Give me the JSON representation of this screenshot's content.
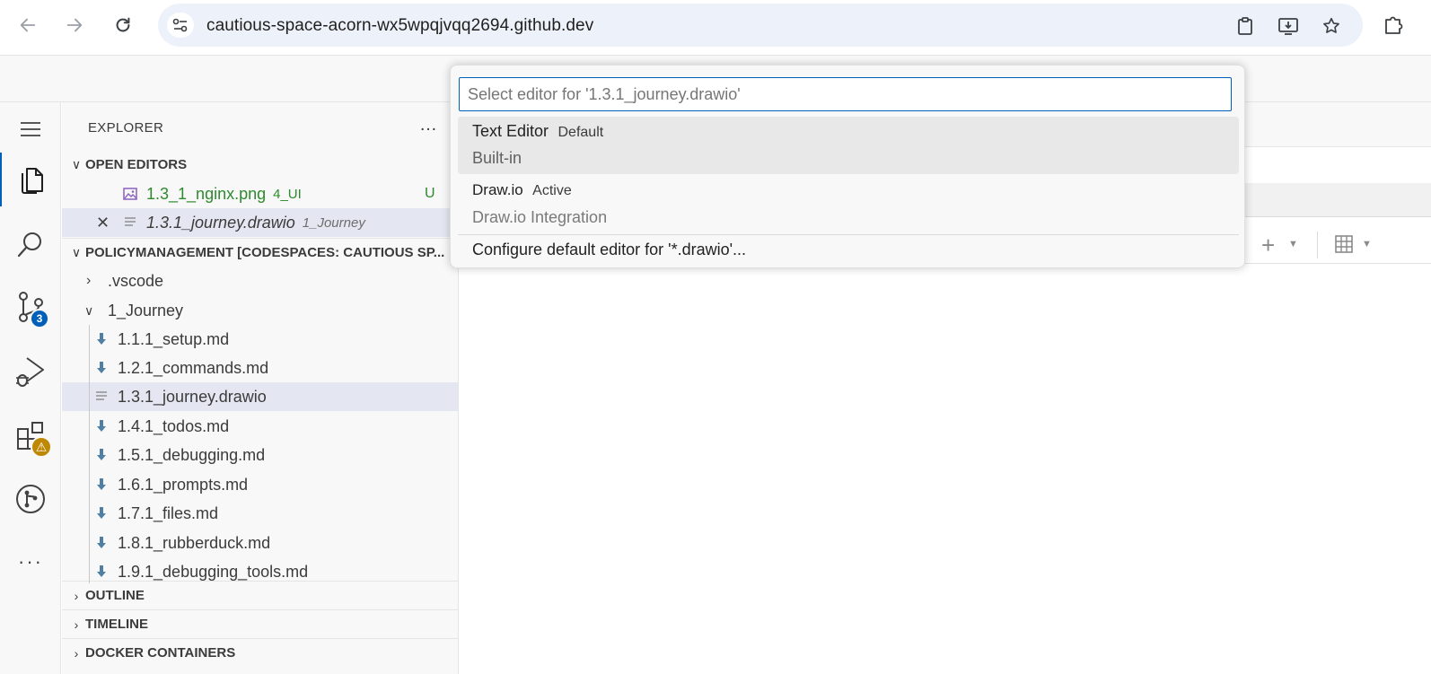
{
  "browser": {
    "url": "cautious-space-acorn-wx5wpqjvqq2694.github.dev"
  },
  "explorer": {
    "title": "EXPLORER",
    "more": "…",
    "open_editors": {
      "header": "OPEN EDITORS",
      "items": [
        {
          "name": "1.3_1_nginx.png",
          "desc": "4_UI",
          "status": "U"
        },
        {
          "name": "1.3.1_journey.drawio",
          "desc": "1_Journey"
        }
      ]
    },
    "workspace": {
      "header": "POLICYMANAGEMENT [CODESPACES: CAUTIOUS SP...",
      "folders": [
        {
          "name": ".vscode"
        },
        {
          "name": "1_Journey"
        }
      ],
      "files": [
        "1.1.1_setup.md",
        "1.2.1_commands.md",
        "1.3.1_journey.drawio",
        "1.4.1_todos.md",
        "1.5.1_debugging.md",
        "1.6.1_prompts.md",
        "1.7.1_files.md",
        "1.8.1_rubberduck.md",
        "1.9.1_debugging_tools.md"
      ]
    },
    "outline": "OUTLINE",
    "timeline": "TIMELINE",
    "docker": "DOCKER CONTAINERS"
  },
  "activity": {
    "source_control_badge": "3",
    "extensions_badge": "⚠",
    "more": "···"
  },
  "quick_pick": {
    "placeholder": "Select editor for '1.3.1_journey.drawio'",
    "items": [
      {
        "label": "Text Editor",
        "desc": "Default",
        "detail": "Built-in"
      },
      {
        "label": "Draw.io",
        "desc": "Active",
        "detail": "Draw.io Integration"
      }
    ],
    "configure": "Configure default editor for '*.drawio'..."
  }
}
